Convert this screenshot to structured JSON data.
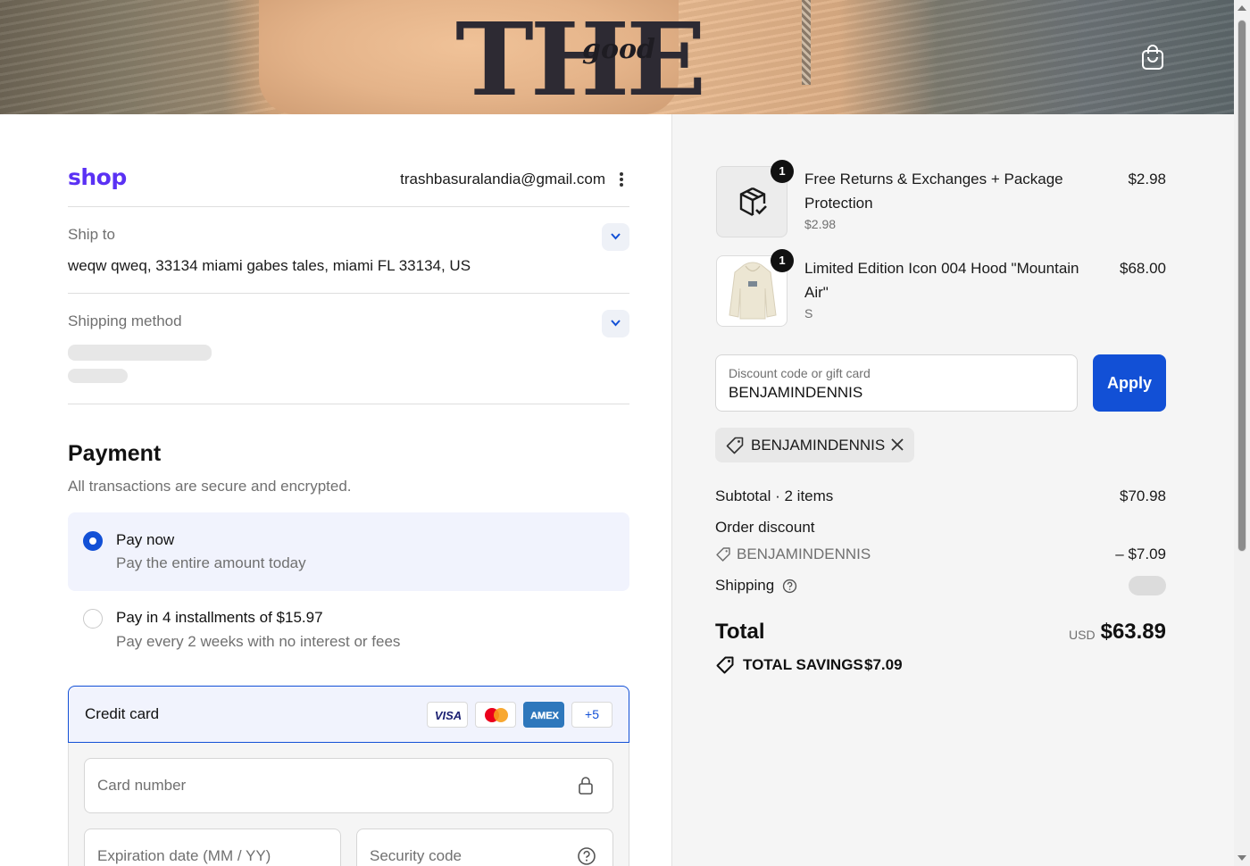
{
  "hero": {
    "shirt_text": "THE",
    "shirt_logo": "good",
    "cart_icon": "shopping-bag-icon"
  },
  "account": {
    "brand": "shop",
    "email": "trashbasuralandia@gmail.com"
  },
  "ship_to": {
    "label": "Ship to",
    "address": "weqw qweq, 33134 miami gabes tales, miami FL 33134, US"
  },
  "shipping_method": {
    "label": "Shipping method"
  },
  "payment": {
    "heading": "Payment",
    "subheading": "All transactions are secure and encrypted.",
    "options": [
      {
        "title": "Pay now",
        "subtitle": "Pay the entire amount today",
        "selected": true
      },
      {
        "title": "Pay in 4 installments of $15.97",
        "subtitle": "Pay every 2 weeks with no interest or fees",
        "selected": false
      }
    ],
    "credit_card": {
      "label": "Credit card",
      "brands": [
        "VISA",
        "mastercard",
        "AMEX"
      ],
      "more": "+5",
      "card_number_placeholder": "Card number",
      "expiration_placeholder": "Expiration date (MM / YY)",
      "security_placeholder": "Security code"
    }
  },
  "cart": {
    "items": [
      {
        "name": "Free Returns & Exchanges + Package Protection",
        "variant": "$2.98",
        "price": "$2.98",
        "quantity": "1"
      },
      {
        "name": "Limited Edition Icon 004 Hood \"Mountain Air\"",
        "variant": "S",
        "price": "$68.00",
        "quantity": "1"
      }
    ]
  },
  "discount": {
    "input_label": "Discount code or gift card",
    "input_value": "BENJAMINDENNIS",
    "apply_label": "Apply",
    "applied_code": "BENJAMINDENNIS"
  },
  "totals": {
    "subtotal_label": "Subtotal · 2 items",
    "subtotal_value": "$70.98",
    "order_discount_label": "Order discount",
    "order_discount_code": "BENJAMINDENNIS",
    "order_discount_value": "– $7.09",
    "shipping_label": "Shipping",
    "total_label": "Total",
    "currency": "USD",
    "total_value": "$63.89",
    "savings_label": "TOTAL SAVINGS",
    "savings_value": "$7.09"
  },
  "colors": {
    "accent": "#1250d6",
    "shop_brand": "#5a31f4",
    "summary_bg": "#f5f5f5"
  }
}
